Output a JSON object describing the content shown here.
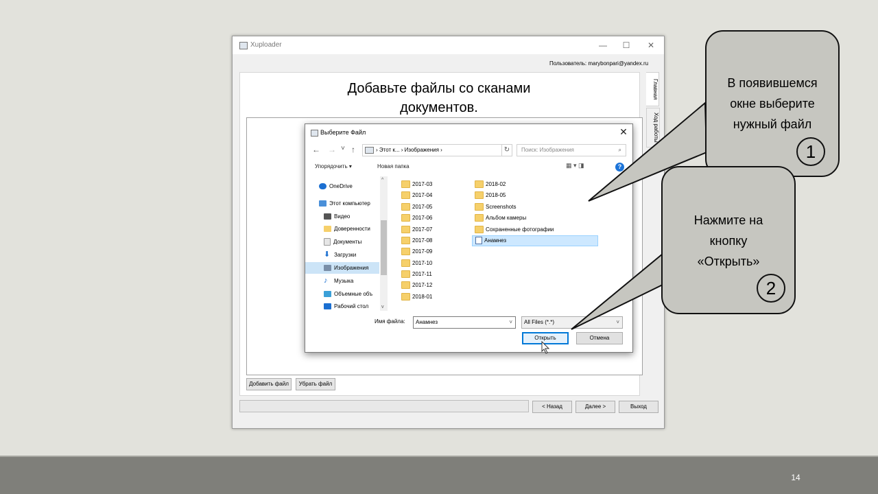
{
  "app": {
    "title": "Xuploader",
    "controls": {
      "minimize": "—",
      "maximize": "☐",
      "close": "✕"
    },
    "user_label": "Пользователь:  marybonpari@yandex.ru",
    "heading_line1": "Добавьте файлы со сканами",
    "heading_line2": "документов.",
    "tabs": [
      "Главная",
      "Ход работы"
    ],
    "buttons": {
      "add_file": "Добавить файл",
      "remove_file": "Убрать файл",
      "back": "< Назад",
      "next": "Далее >",
      "exit": "Выход"
    }
  },
  "dialog": {
    "title": "Выберите Файл",
    "close": "✕",
    "nav": {
      "back": "←",
      "forward": "→",
      "up": "↑",
      "dropdown": "˅"
    },
    "address": "›  Этот к...  ›  Изображения  ›",
    "refresh": "↻",
    "search_placeholder": "Поиск: Изображения",
    "search_glyph": "⌕",
    "organize": "Упорядочить ▾",
    "new_folder": "Новая папка",
    "view_glyph": "▦ ▾   ◨",
    "help": "?",
    "nav_items": [
      {
        "label": "OneDrive",
        "icon": "cloud-icon",
        "color": "#1b6fd1"
      },
      {
        "label": "Этот компьютер",
        "icon": "computer-icon",
        "color": "#4a90d9"
      },
      {
        "label": "Видео",
        "icon": "video-icon",
        "color": "#555555"
      },
      {
        "label": "Доверенности",
        "icon": "folder-icon",
        "color": "#f6d06b"
      },
      {
        "label": "Документы",
        "icon": "document-icon",
        "color": "#a0a0a0"
      },
      {
        "label": "Загрузки",
        "icon": "download-icon",
        "color": "#1b6fd1"
      },
      {
        "label": "Изображения",
        "icon": "pictures-icon",
        "color": "#7a8fa8"
      },
      {
        "label": "Музыка",
        "icon": "music-icon",
        "color": "#1b6fd1"
      },
      {
        "label": "Объемные объ",
        "icon": "cube-icon",
        "color": "#3ba0d8"
      },
      {
        "label": "Рабочий стол",
        "icon": "desktop-icon",
        "color": "#1b6fd1"
      }
    ],
    "selected_nav": "Изображения",
    "folders_col1": [
      "2017-03",
      "2017-04",
      "2017-05",
      "2017-06",
      "2017-07",
      "2017-08",
      "2017-09",
      "2017-10",
      "2017-11",
      "2017-12",
      "2018-01"
    ],
    "folders_col2": [
      "2018-02",
      "2018-05",
      "Screenshots",
      "Альбом камеры",
      "Сохраненные фотографии"
    ],
    "selected_file": "Анамнез",
    "file_name_label": "Имя файла:",
    "file_name_value": "Анамнез",
    "file_type": "All Files (*.*)",
    "open_label": "Открыть",
    "cancel_label": "Отмена"
  },
  "callouts": [
    {
      "text_lines": [
        "В появившемся",
        "окне выберите",
        "нужный файл"
      ],
      "number": "1"
    },
    {
      "text_lines": [
        "Нажмите на",
        "кнопку",
        "«Открыть»"
      ],
      "number": "2"
    }
  ],
  "slide_number": "14"
}
